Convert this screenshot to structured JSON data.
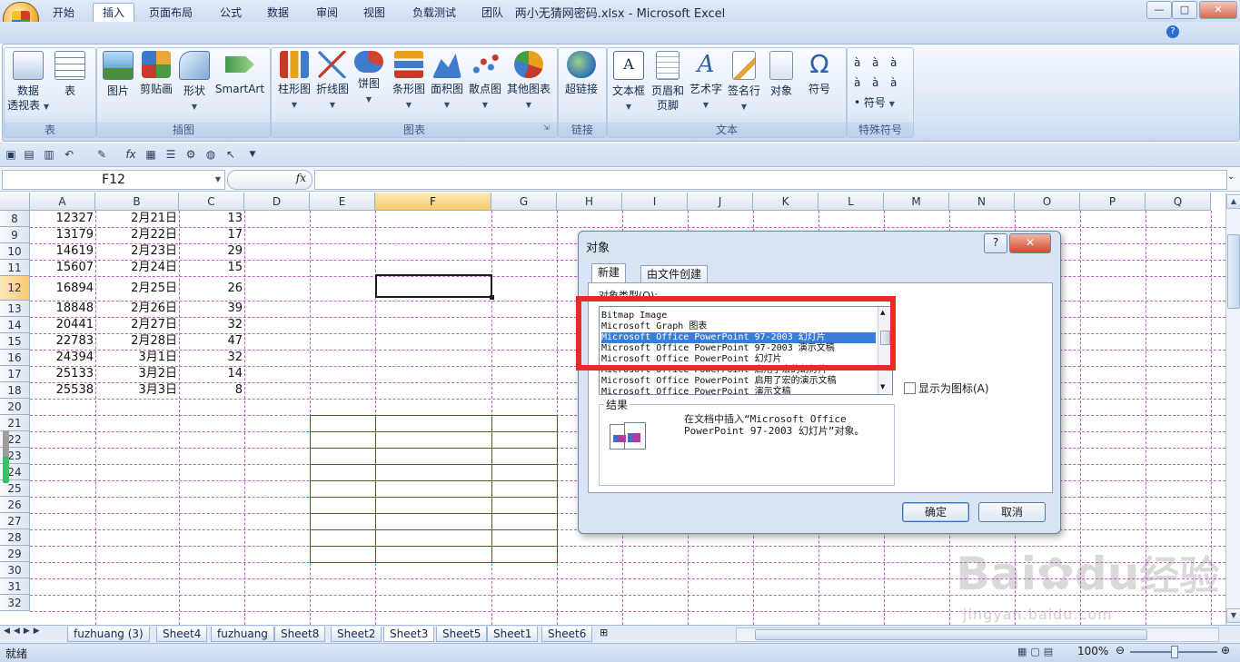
{
  "window": {
    "title": "两小无猜网密码.xlsx - Microsoft Excel",
    "min": "—",
    "max": "□",
    "close": "✕"
  },
  "ribbon_tabs": [
    "开始",
    "插入",
    "页面布局",
    "公式",
    "数据",
    "审阅",
    "视图",
    "负载测试",
    "团队"
  ],
  "active_tab": "插入",
  "groups": [
    {
      "label": "表",
      "buttons": [
        "数据\n透视表",
        "表"
      ]
    },
    {
      "label": "插图",
      "buttons": [
        "图片",
        "剪贴画",
        "形状",
        "SmartArt"
      ]
    },
    {
      "label": "图表",
      "buttons": [
        "柱形图",
        "折线图",
        "饼图",
        "条形图",
        "面积图",
        "散点图",
        "其他图表"
      ]
    },
    {
      "label": "链接",
      "buttons": [
        "超链接"
      ]
    },
    {
      "label": "文本",
      "buttons": [
        "文本框",
        "页眉和\n页脚",
        "艺术字",
        "签名行",
        "对象",
        "符号"
      ]
    },
    {
      "label": "特殊符号",
      "buttons": [
        "符号"
      ]
    }
  ],
  "special_symbols": [
    "à",
    "à",
    "à",
    "à",
    "à",
    "à",
    "•"
  ],
  "namebox": "F12",
  "fx_label": "fx",
  "columns": [
    "A",
    "B",
    "C",
    "D",
    "E",
    "F",
    "G",
    "H",
    "I",
    "J",
    "K",
    "L",
    "M",
    "N",
    "O",
    "P",
    "Q"
  ],
  "selected_column": "F",
  "rows": [
    {
      "n": "8",
      "a": "12327",
      "b": "2月21日",
      "c": "13"
    },
    {
      "n": "9",
      "a": "13179",
      "b": "2月22日",
      "c": "17"
    },
    {
      "n": "10",
      "a": "14619",
      "b": "2月23日",
      "c": "29"
    },
    {
      "n": "11",
      "a": "15607",
      "b": "2月24日",
      "c": "15"
    },
    {
      "n": "12",
      "a": "16894",
      "b": "2月25日",
      "c": "26"
    },
    {
      "n": "13",
      "a": "18848",
      "b": "2月26日",
      "c": "39"
    },
    {
      "n": "14",
      "a": "20441",
      "b": "2月27日",
      "c": "32"
    },
    {
      "n": "15",
      "a": "22783",
      "b": "2月28日",
      "c": "47"
    },
    {
      "n": "16",
      "a": "24394",
      "b": "3月1日",
      "c": "32"
    },
    {
      "n": "17",
      "a": "25133",
      "b": "3月2日",
      "c": "14"
    },
    {
      "n": "18",
      "a": "25538",
      "b": "3月3日",
      "c": "8"
    },
    {
      "n": "20"
    },
    {
      "n": "21"
    },
    {
      "n": "22"
    },
    {
      "n": "23"
    },
    {
      "n": "24"
    },
    {
      "n": "25"
    },
    {
      "n": "26"
    },
    {
      "n": "27"
    },
    {
      "n": "28"
    },
    {
      "n": "29"
    },
    {
      "n": "30"
    },
    {
      "n": "31"
    },
    {
      "n": "32"
    }
  ],
  "sheets": [
    "fuzhuang (3)",
    "Sheet4",
    "fuzhuang",
    "Sheet8",
    "Sheet2",
    "Sheet3",
    "Sheet5",
    "Sheet1",
    "Sheet6"
  ],
  "active_sheet": "Sheet3",
  "status": {
    "ready": "就绪",
    "zoom": "100%"
  },
  "dialog": {
    "title": "对象",
    "help": "?",
    "close": "✕",
    "tabs": [
      "新建",
      "由文件创建"
    ],
    "type_label": "对象类型(O):",
    "items": [
      "Bitmap Image",
      "Microsoft Graph 图表",
      "Microsoft Office PowerPoint 97-2003 幻灯片",
      "Microsoft Office PowerPoint 97-2003 演示文稿",
      "Microsoft Office PowerPoint 幻灯片",
      "Microsoft Office PowerPoint 启用了宏的幻灯片",
      "Microsoft Office PowerPoint 启用了宏的演示文稿",
      "Microsoft Office PowerPoint 演示文稿"
    ],
    "selected_index": 2,
    "show_as_icon": "显示为图标(A)",
    "result_label": "结果",
    "result_text_1": "在文档中插入“Microsoft Office",
    "result_text_2": "PowerPoint 97-2003 幻灯片”对象。",
    "ok": "确定",
    "cancel": "取消"
  },
  "watermark": {
    "brand": "Bai",
    "brand2": "du",
    "cn": "经验",
    "url": "jingyan.baidu.com"
  },
  "colors": {
    "accent": "#3b7ddb",
    "highlight": "#ee2727",
    "gridline": "#c55bd0",
    "redbox": "#d01e1e"
  }
}
